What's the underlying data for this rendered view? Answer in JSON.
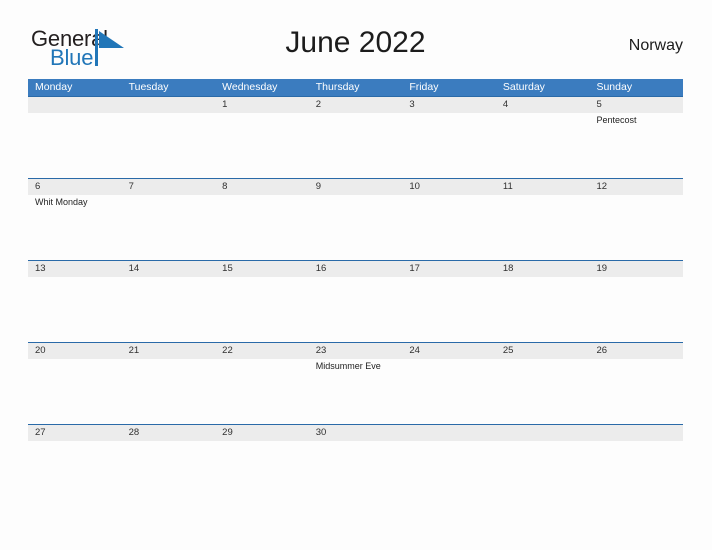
{
  "brand": {
    "name_part1": "General",
    "name_part2": "Blue",
    "flag_icon": "blue-triangle-flag-icon",
    "color_dark": "#231f20",
    "color_blue": "#2176b8"
  },
  "header": {
    "title": "June 2022",
    "country": "Norway"
  },
  "theme": {
    "header_blue": "#3b7cbf",
    "row_band_gray": "#ececec",
    "row_divider_blue": "#2a6aa8",
    "page_background": "#fdfdfd"
  },
  "calendar": {
    "month": "June",
    "year": "2022",
    "weekday_headers": [
      "Monday",
      "Tuesday",
      "Wednesday",
      "Thursday",
      "Friday",
      "Saturday",
      "Sunday"
    ],
    "weeks": [
      [
        {
          "date": "",
          "event": ""
        },
        {
          "date": "",
          "event": ""
        },
        {
          "date": "1",
          "event": ""
        },
        {
          "date": "2",
          "event": ""
        },
        {
          "date": "3",
          "event": ""
        },
        {
          "date": "4",
          "event": ""
        },
        {
          "date": "5",
          "event": "Pentecost"
        }
      ],
      [
        {
          "date": "6",
          "event": "Whit Monday"
        },
        {
          "date": "7",
          "event": ""
        },
        {
          "date": "8",
          "event": ""
        },
        {
          "date": "9",
          "event": ""
        },
        {
          "date": "10",
          "event": ""
        },
        {
          "date": "11",
          "event": ""
        },
        {
          "date": "12",
          "event": ""
        }
      ],
      [
        {
          "date": "13",
          "event": ""
        },
        {
          "date": "14",
          "event": ""
        },
        {
          "date": "15",
          "event": ""
        },
        {
          "date": "16",
          "event": ""
        },
        {
          "date": "17",
          "event": ""
        },
        {
          "date": "18",
          "event": ""
        },
        {
          "date": "19",
          "event": ""
        }
      ],
      [
        {
          "date": "20",
          "event": ""
        },
        {
          "date": "21",
          "event": ""
        },
        {
          "date": "22",
          "event": ""
        },
        {
          "date": "23",
          "event": "Midsummer Eve"
        },
        {
          "date": "24",
          "event": ""
        },
        {
          "date": "25",
          "event": ""
        },
        {
          "date": "26",
          "event": ""
        }
      ],
      [
        {
          "date": "27",
          "event": ""
        },
        {
          "date": "28",
          "event": ""
        },
        {
          "date": "29",
          "event": ""
        },
        {
          "date": "30",
          "event": ""
        },
        {
          "date": "",
          "event": ""
        },
        {
          "date": "",
          "event": ""
        },
        {
          "date": "",
          "event": ""
        }
      ]
    ]
  }
}
